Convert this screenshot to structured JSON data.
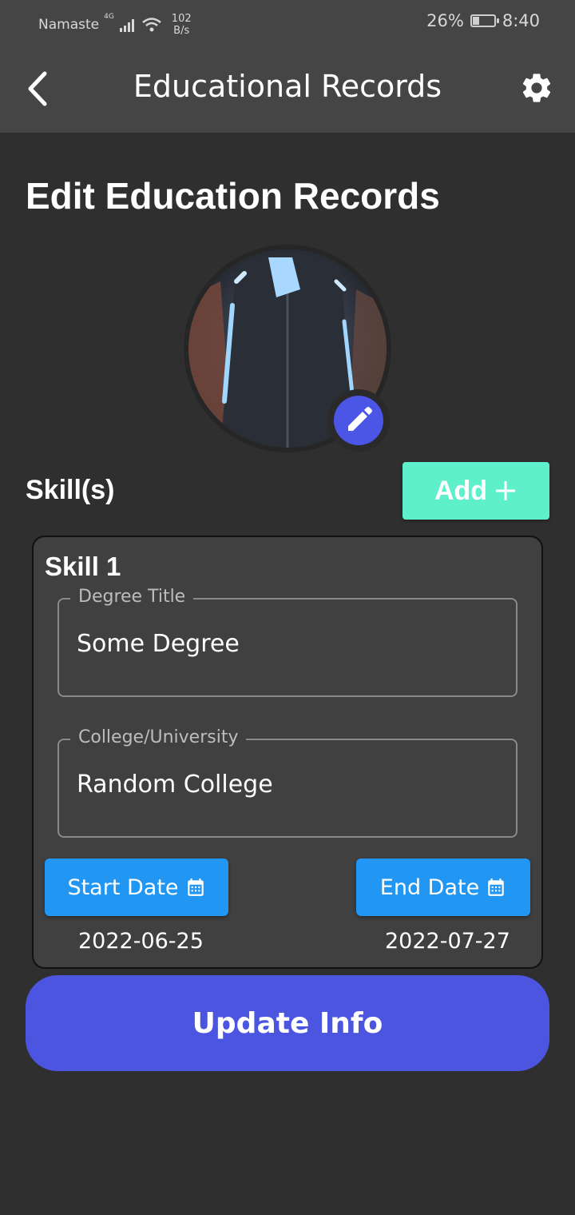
{
  "status_bar": {
    "carrier": "Namaste",
    "network_type": "4G",
    "net_speed_value": "102",
    "net_speed_unit": "B/s",
    "battery": "26%",
    "time": "8:40"
  },
  "app_bar": {
    "title": "Educational Records",
    "back_icon": "chevron-left-icon",
    "settings_icon": "gear-icon"
  },
  "page": {
    "heading": "Edit Education Records",
    "edit_photo_icon": "pencil-icon"
  },
  "skills": {
    "label": "Skill(s)",
    "add_label": "Add",
    "add_icon": "plus-icon"
  },
  "skill_card": {
    "title": "Skill 1",
    "degree_label": "Degree Title",
    "degree_value": "Some Degree",
    "college_label": "College/University",
    "college_value": "Random College",
    "start_date_label": "Start Date",
    "start_date_value": "2022-06-25",
    "end_date_label": "End Date",
    "end_date_value": "2022-07-27",
    "calendar_icon": "calendar-icon"
  },
  "update_button": "Update Info",
  "colors": {
    "background": "#2f2f2f",
    "app_bar": "#454545",
    "add_button": "#5ef0cb",
    "date_button": "#2196f3",
    "update_button": "#4b55e0",
    "edit_avatar": "#4b55e6"
  }
}
